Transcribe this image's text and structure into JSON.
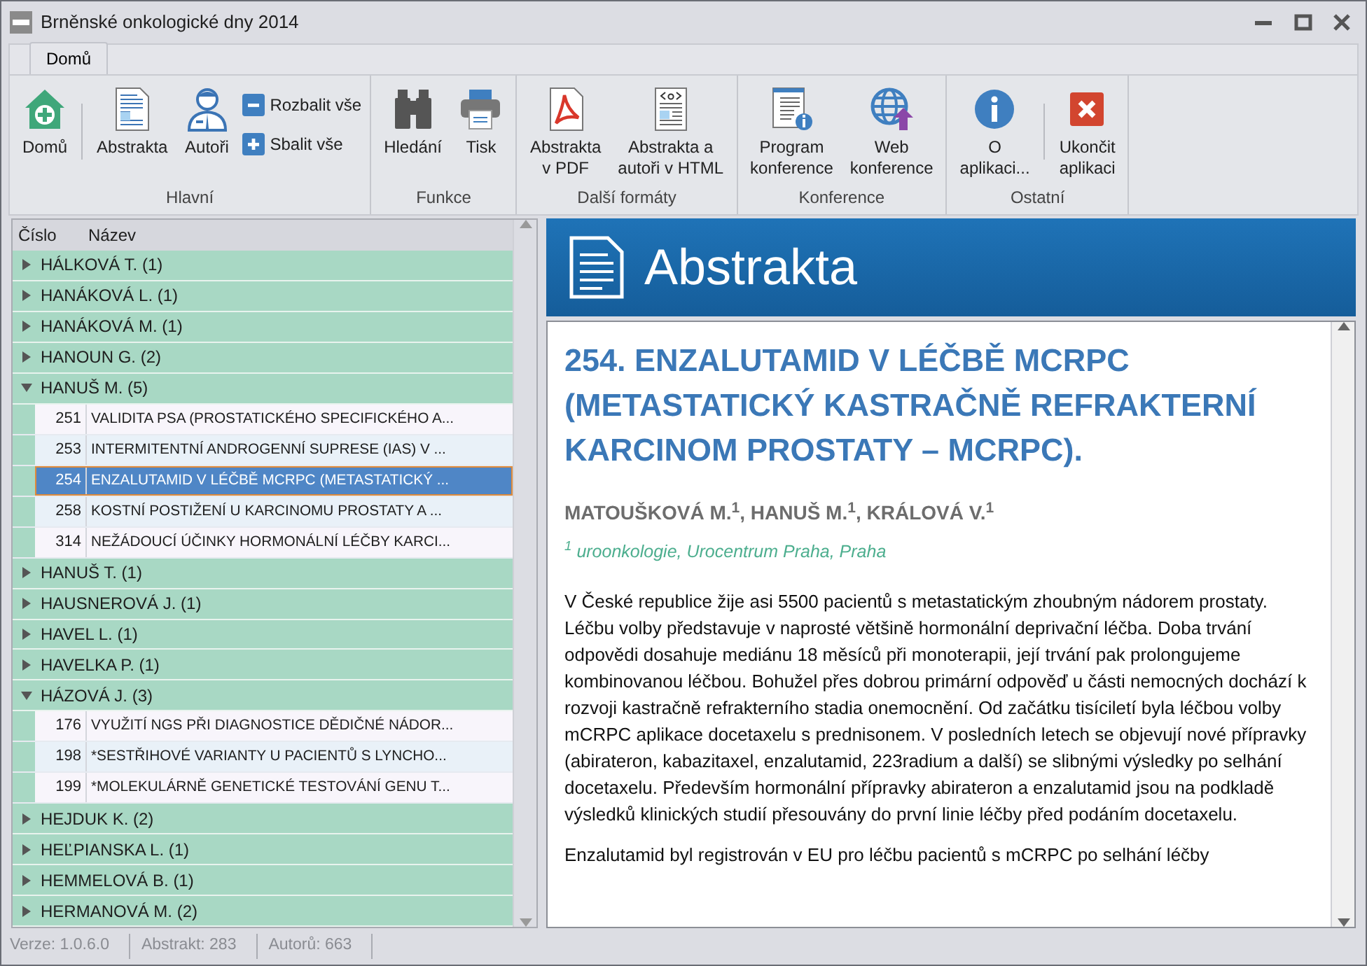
{
  "window": {
    "title": "Brněnské onkologické dny 2014"
  },
  "tabs": [
    {
      "label": "Domů",
      "selected": true
    }
  ],
  "ribbon": {
    "groups": [
      {
        "label": "Hlavní",
        "items": [
          {
            "kind": "large",
            "label": "Domů"
          },
          {
            "kind": "separator"
          },
          {
            "kind": "large",
            "label": "Abstrakta"
          },
          {
            "kind": "large",
            "label": "Autoři"
          },
          {
            "kind": "small",
            "label": "Rozbalit vše"
          },
          {
            "kind": "small",
            "label": "Sbalit vše"
          }
        ]
      },
      {
        "label": "Funkce",
        "items": [
          {
            "kind": "large",
            "label": "Hledání"
          },
          {
            "kind": "large",
            "label": "Tisk"
          }
        ]
      },
      {
        "label": "Další formáty",
        "items": [
          {
            "kind": "large",
            "label": "Abstrakta\nv PDF"
          },
          {
            "kind": "large",
            "label": "Abstrakta a\nautoři v HTML"
          }
        ]
      },
      {
        "label": "Konference",
        "items": [
          {
            "kind": "large",
            "label": "Program\nkonference"
          },
          {
            "kind": "large",
            "label": "Web\nkonference"
          }
        ]
      },
      {
        "label": "Ostatní",
        "items": [
          {
            "kind": "large",
            "label": "O\naplikaci..."
          },
          {
            "kind": "separator"
          },
          {
            "kind": "large",
            "label": "Ukončit\naplikaci"
          }
        ]
      }
    ]
  },
  "tree": {
    "columns": [
      "Číslo",
      "Název"
    ],
    "authors": [
      {
        "label": "HÁLKOVÁ T. (1)",
        "expanded": false
      },
      {
        "label": "HANÁKOVÁ L. (1)",
        "expanded": false
      },
      {
        "label": "HANÁKOVÁ M. (1)",
        "expanded": false
      },
      {
        "label": "HANOUN G. (2)",
        "expanded": false
      },
      {
        "label": "HANUŠ M. (5)",
        "expanded": true,
        "children": [
          {
            "number": "251",
            "title": "VALIDITA PSA (PROSTATICKÉHO SPECIFICKÉHO A...",
            "selected": false
          },
          {
            "number": "253",
            "title": "INTERMITENTNÍ ANDROGENNÍ SUPRESE (IAS) V ...",
            "selected": false
          },
          {
            "number": "254",
            "title": "ENZALUTAMID V LÉČBĚ MCRPC (METASTATICKÝ ...",
            "selected": true
          },
          {
            "number": "258",
            "title": "KOSTNÍ POSTIŽENÍ U KARCINOMU PROSTATY A ...",
            "selected": false
          },
          {
            "number": "314",
            "title": "NEŽÁDOUCÍ ÚČINKY HORMONÁLNÍ LÉČBY KARCI...",
            "selected": false
          }
        ]
      },
      {
        "label": "HANUŠ T. (1)",
        "expanded": false
      },
      {
        "label": "HAUSNEROVÁ J. (1)",
        "expanded": false
      },
      {
        "label": "HAVEL L. (1)",
        "expanded": false
      },
      {
        "label": "HAVELKA P. (1)",
        "expanded": false
      },
      {
        "label": "HÁZOVÁ J. (3)",
        "expanded": true,
        "children": [
          {
            "number": "176",
            "title": "VYUŽITÍ NGS PŘI DIAGNOSTICE DĚDIČNÉ NÁDOR...",
            "selected": false
          },
          {
            "number": "198",
            "title": "*SESTŘIHOVÉ VARIANTY U PACIENTŮ S LYNCHO...",
            "selected": false
          },
          {
            "number": "199",
            "title": "*MOLEKULÁRNĚ GENETICKÉ TESTOVÁNÍ GENU T...",
            "selected": false
          }
        ]
      },
      {
        "label": "HEJDUK K. (2)",
        "expanded": false
      },
      {
        "label": "HEĽPIANSKA L. (1)",
        "expanded": false
      },
      {
        "label": "HEMMELOVÁ B. (1)",
        "expanded": false
      },
      {
        "label": "HERMANOVÁ M. (2)",
        "expanded": false
      }
    ]
  },
  "document": {
    "banner": "Abstrakta",
    "title": "254. ENZALUTAMID V LÉČBĚ MCRPC (METASTATICKÝ KASTRAČNĚ REFRAKTERNÍ KARCINOM PROSTATY – MCRPC).",
    "authors": "MATOUŠKOVÁ M.$^{1}$, HANUŠ M.$^{1}$, KRÁLOVÁ V.$^{1}$",
    "affiliation": "$^{1}$ uroonkologie, Urocentrum Praha, Praha",
    "paragraphs": [
      "V České republice žije asi 5500 pacientů s metastatickým zhoubným nádorem prostaty. Léčbu volby představuje v naprosté většině hormonální deprivační léčba. Doba trvání odpovědi dosahuje mediánu 18 měsíců při monoterapii, její trvání pak prolongujeme kombinovanou léčbou. Bohužel přes dobrou primární odpověď u části nemocných dochází k rozvoji kastračně refrakterního stadia onemocnění. Od začátku tisíciletí byla léčbou volby mCRPC aplikace docetaxelu s prednisonem. V posledních letech se objevují nové přípravky (abirateron, kabazitaxel, enzalutamid, 223radium a další) se slibnými výsledky po selhání docetaxelu. Především hormonální přípravky abirateron a enzalutamid jsou na podkladě výsledků klinických studií přesouvány do první linie léčby před podáním docetaxelu.",
      "Enzalutamid byl registrován v EU pro léčbu pacientů s mCRPC po selhání léčby"
    ]
  },
  "status_bar": [
    "Verze: 1.0.6.0",
    "Abstrakt: 283",
    "Autorů: 663"
  ]
}
